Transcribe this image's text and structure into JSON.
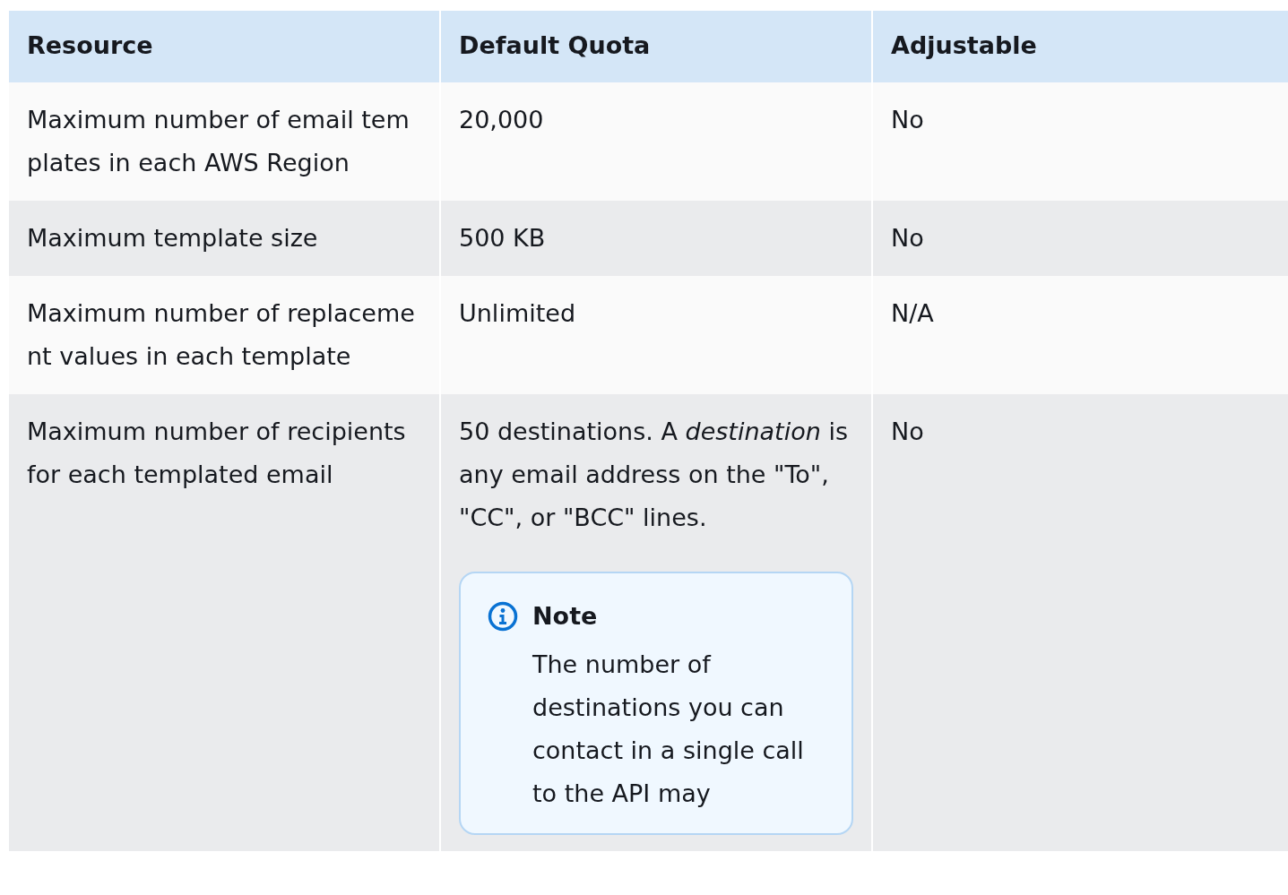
{
  "table": {
    "columns": [
      "Resource",
      "Default Quota",
      "Adjustable"
    ],
    "rows": [
      {
        "resource": "Maximum number of email templates in each AWS Region",
        "quota": "20,000",
        "adjustable": "No"
      },
      {
        "resource": "Maximum template size",
        "quota": "500 KB",
        "adjustable": "No"
      },
      {
        "resource": "Maximum number of replacement values in each template",
        "quota": "Unlimited",
        "adjustable": "N/A"
      },
      {
        "resource": "Maximum number of recipients for each templated email",
        "quota": "50 destinations. A *destination* is any email address on the \"To\", \"CC\", or \"BCC\" lines.",
        "note": {
          "title": "Note",
          "text": "The number of destinations you can contact in a single call to the API may"
        },
        "adjustable": "No"
      }
    ]
  }
}
